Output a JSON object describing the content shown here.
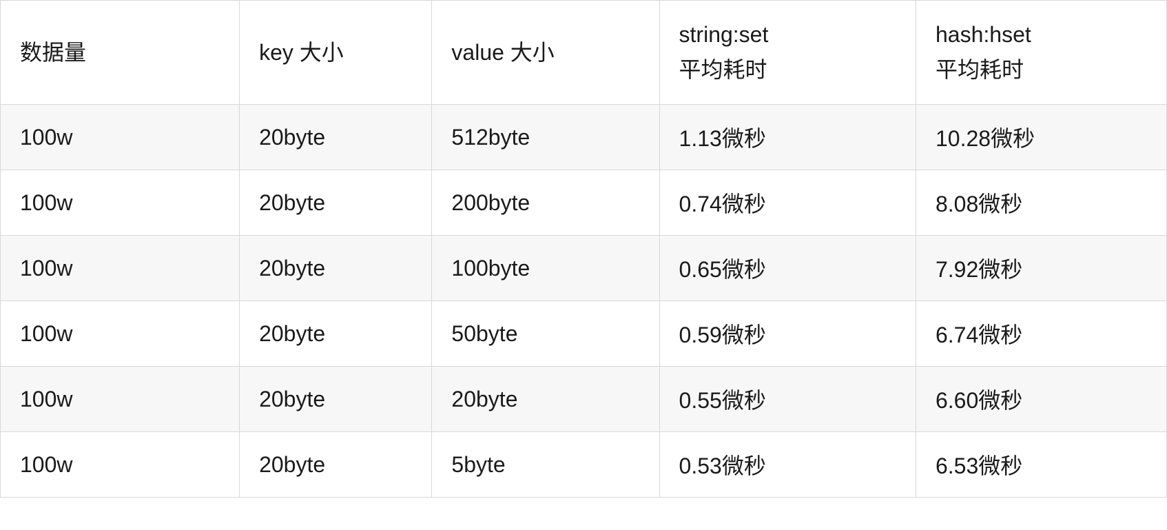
{
  "table": {
    "headers": [
      "数据量",
      "key 大小",
      "value 大小",
      "string:set\n平均耗时",
      "hash:hset\n平均耗时"
    ],
    "rows": [
      [
        "100w",
        "20byte",
        "512byte",
        "1.13微秒",
        "10.28微秒"
      ],
      [
        "100w",
        "20byte",
        "200byte",
        "0.74微秒",
        "8.08微秒"
      ],
      [
        "100w",
        "20byte",
        "100byte",
        "0.65微秒",
        "7.92微秒"
      ],
      [
        "100w",
        "20byte",
        "50byte",
        "0.59微秒",
        "6.74微秒"
      ],
      [
        "100w",
        "20byte",
        "20byte",
        "0.55微秒",
        "6.60微秒"
      ],
      [
        "100w",
        "20byte",
        "5byte",
        "0.53微秒",
        "6.53微秒"
      ]
    ]
  },
  "chart_data": {
    "type": "table",
    "columns": [
      "数据量",
      "key 大小",
      "value 大小",
      "string:set 平均耗时",
      "hash:hset 平均耗时"
    ],
    "data": [
      {
        "数据量": "100w",
        "key 大小": "20byte",
        "value 大小": "512byte",
        "string:set 平均耗时": "1.13微秒",
        "hash:hset 平均耗时": "10.28微秒"
      },
      {
        "数据量": "100w",
        "key 大小": "20byte",
        "value 大小": "200byte",
        "string:set 平均耗时": "0.74微秒",
        "hash:hset 平均耗时": "8.08微秒"
      },
      {
        "数据量": "100w",
        "key 大小": "20byte",
        "value 大小": "100byte",
        "string:set 平均耗时": "0.65微秒",
        "hash:hset 平均耗时": "7.92微秒"
      },
      {
        "数据量": "100w",
        "key 大小": "20byte",
        "value 大小": "50byte",
        "string:set 平均耗时": "0.59微秒",
        "hash:hset 平均耗时": "6.74微秒"
      },
      {
        "数据量": "100w",
        "key 大小": "20byte",
        "value 大小": "20byte",
        "string:set 平均耗时": "0.55微秒",
        "hash:hset 平均耗时": "6.60微秒"
      },
      {
        "数据量": "100w",
        "key 大小": "20byte",
        "value 大小": "5byte",
        "string:set 平均耗时": "0.53微秒",
        "hash:hset 平均耗时": "6.53微秒"
      }
    ]
  }
}
